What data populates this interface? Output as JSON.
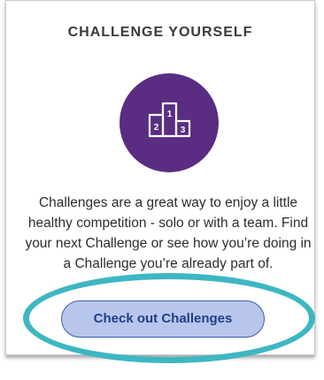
{
  "card": {
    "title": "CHALLENGE YOURSELF",
    "icon": "podium-icon",
    "description": "Challenges are a great way to enjoy a little healthy competition - solo or with a team. Find your next Challenge or see how you’re doing in a Challenge you’re already part of.",
    "button_label": "Check out Challenges"
  },
  "podium": {
    "place_1": "1",
    "place_2": "2",
    "place_3": "3"
  },
  "colors": {
    "icon_circle": "#5a2d82",
    "button_fill": "#b8c6ee",
    "button_text": "#1f3f86",
    "highlight_ring": "#3db7c2"
  }
}
